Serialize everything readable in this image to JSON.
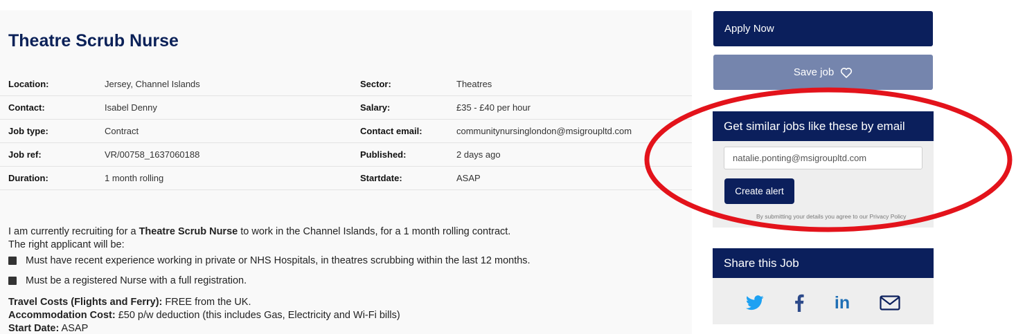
{
  "job": {
    "title": "Theatre Scrub Nurse",
    "details": [
      {
        "label1": "Location:",
        "value1": "Jersey, Channel Islands",
        "label2": "Sector:",
        "value2": "Theatres"
      },
      {
        "label1": "Contact:",
        "value1": "Isabel Denny",
        "label2": "Salary:",
        "value2": "£35 - £40 per hour"
      },
      {
        "label1": "Job type:",
        "value1": "Contract",
        "label2": "Contact email:",
        "value2": "communitynursinglondon@msigroupltd.com"
      },
      {
        "label1": "Job ref:",
        "value1": "VR/00758_1637060188",
        "label2": "Published:",
        "value2": "2 days ago"
      },
      {
        "label1": "Duration:",
        "value1": "1 month rolling",
        "label2": "Startdate:",
        "value2": "ASAP"
      }
    ],
    "description": {
      "intro_before": "I am currently recruiting for a ",
      "intro_bold": "Theatre Scrub Nurse",
      "intro_after": " to work in the Channel Islands, for a 1 month rolling contract.",
      "line2": "The right applicant will be:",
      "bullets": [
        "Must have recent experience working in private or NHS Hospitals, in theatres scrubbing within the last 12 months.",
        "Must be a registered Nurse with a full registration."
      ],
      "extras": [
        {
          "label": "Travel Costs (Flights and Ferry):",
          "value": " FREE from the UK."
        },
        {
          "label": "Accommodation Cost:",
          "value": " £50 p/w deduction (this includes Gas, Electricity and Wi-Fi bills)"
        },
        {
          "label": "Start Date:",
          "value": " ASAP"
        }
      ]
    }
  },
  "sidebar": {
    "apply_label": "Apply Now",
    "save_label": "Save job",
    "alert": {
      "heading": "Get similar jobs like these by email",
      "email_value": "natalie.ponting@msigroupltd.com",
      "button_label": "Create alert",
      "note": "By submitting your details you agree to our Privacy Policy"
    },
    "share": {
      "heading": "Share this Job",
      "icons": [
        "twitter-icon",
        "facebook-icon",
        "linkedin-icon",
        "email-icon"
      ],
      "linkedin_text": "in"
    }
  },
  "colors": {
    "navy": "#0b1f5c",
    "save_button": "#7585ad",
    "annotation_ring": "#e3131b",
    "icon_blue": "#1da1f2"
  }
}
